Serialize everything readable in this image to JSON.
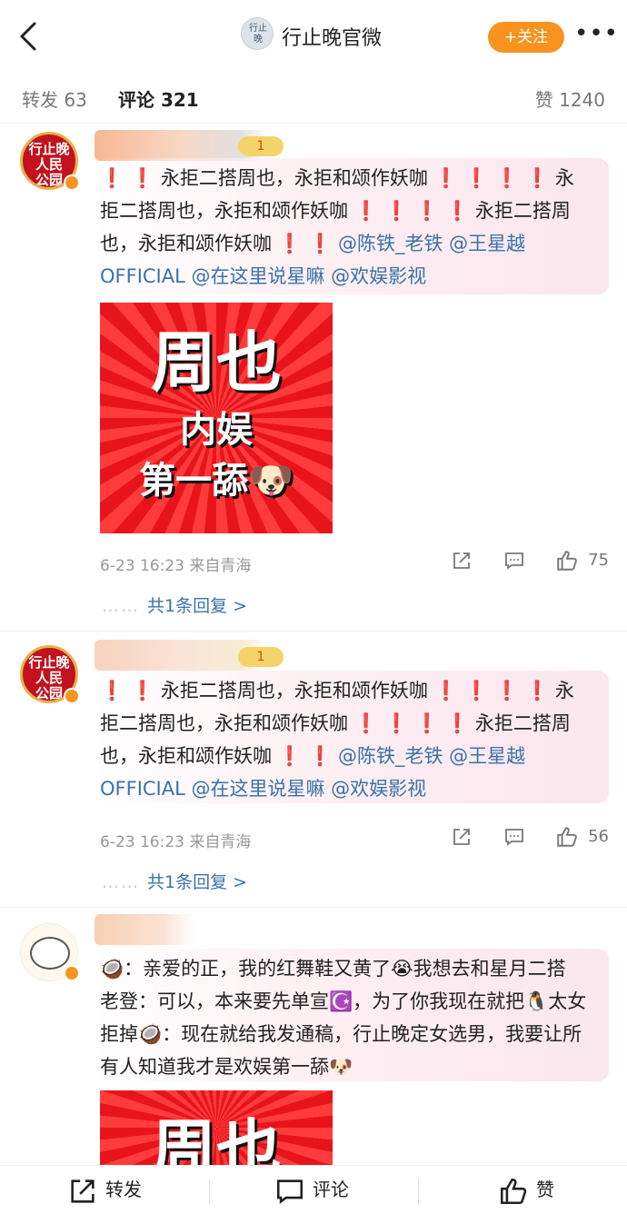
{
  "header": {
    "title": "行止晚官微",
    "avatar_text": "行止晚",
    "follow_label": "+关注",
    "more_label": "•••"
  },
  "tabs": {
    "repost": "转发 63",
    "comment": "评论 321",
    "like": "赞 1240"
  },
  "comments": [
    {
      "avatar_text": "行止晚\n人民\n公园",
      "level_badge": "1",
      "text_parts": [
        {
          "t": "❗ ❗ ",
          "k": "bang"
        },
        {
          "t": "永拒二搭周也，永拒和颂作妖咖 ",
          "k": "text"
        },
        {
          "t": "❗ ❗ ❗ ❗",
          "k": "bang"
        },
        {
          "t": " 永拒二搭周也，永拒和颂作妖咖 ",
          "k": "text"
        },
        {
          "t": "❗ ❗ ❗ ❗",
          "k": "bang"
        },
        {
          "t": " 永拒二搭周也，永拒和颂作妖咖 ",
          "k": "text"
        },
        {
          "t": "❗ ❗",
          "k": "bang"
        },
        {
          "t": " @陈铁_老铁 @王星越OFFICIAL @在这里说星嘛 @欢娱影视",
          "k": "link"
        }
      ],
      "image_text": {
        "line1": "周也",
        "line2": "内娱",
        "line3": "第一舔🐶"
      },
      "time": "6-23 16:23 来自青海",
      "like_count": "75",
      "replies": "共1条回复 >"
    },
    {
      "avatar_text": "行止晚\n人民\n公园",
      "level_badge": "1",
      "text_parts": [
        {
          "t": "❗ ❗ ",
          "k": "bang"
        },
        {
          "t": "永拒二搭周也，永拒和颂作妖咖 ",
          "k": "text"
        },
        {
          "t": "❗ ❗ ❗ ❗",
          "k": "bang"
        },
        {
          "t": " 永拒二搭周也，永拒和颂作妖咖 ",
          "k": "text"
        },
        {
          "t": "❗ ❗ ❗ ❗",
          "k": "bang"
        },
        {
          "t": " 永拒二搭周也，永拒和颂作妖咖 ",
          "k": "text"
        },
        {
          "t": "❗ ❗",
          "k": "bang"
        },
        {
          "t": " @陈铁_老铁 @王星越OFFICIAL @在这里说星嘛 @欢娱影视",
          "k": "link"
        }
      ],
      "time": "6-23 16:23 来自青海",
      "like_count": "56",
      "replies": "共1条回复 >"
    },
    {
      "text_parts": [
        {
          "t": "🥥：亲爱的正，我的红舞鞋又黄了😭我想去和星月二搭 老登：可以，本来要先单宣☪️，为了你我现在就把🐧太女拒掉🥥：现在就给我发通稿，行止晚定女选男，我要让所有人知道我才是欢娱第一舔🐶",
          "k": "text"
        }
      ],
      "image_text": {
        "line1": "周也"
      }
    }
  ],
  "bottom_bar": {
    "repost": "转发",
    "comment": "评论",
    "like": "赞"
  }
}
